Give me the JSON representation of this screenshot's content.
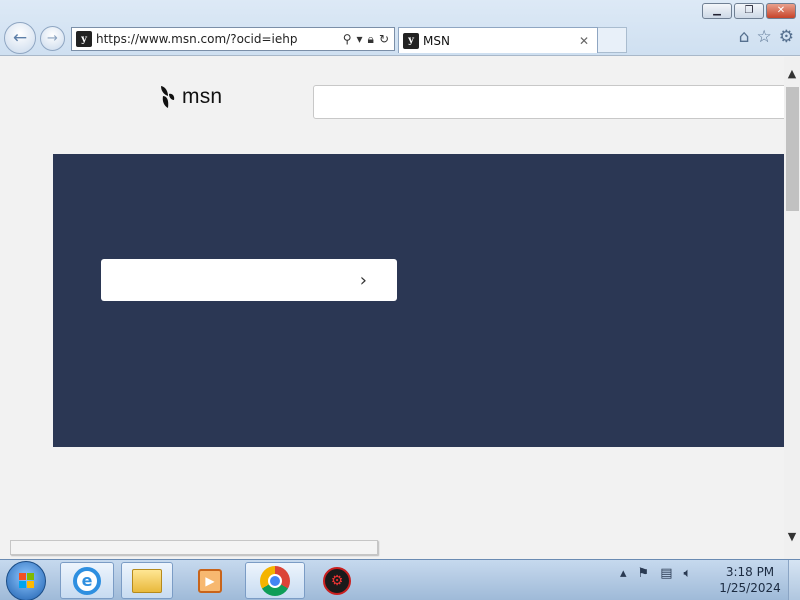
{
  "window": {
    "minimize_icon": "minimize-icon",
    "maximize_icon": "restore-icon",
    "close_icon": "close-icon"
  },
  "browser": {
    "address": {
      "url": "https://www.msn.com/?ocid=iehp",
      "site_icon": "msn-favicon"
    },
    "tabs": [
      {
        "label": "MSN",
        "icon": "msn-favicon"
      }
    ],
    "command_icons": [
      "home-icon",
      "favorites-icon",
      "gear-icon"
    ]
  },
  "page": {
    "logo": {
      "text": "msn",
      "icon": "butterfly-icon"
    },
    "search": {
      "value": "",
      "placeholder": ""
    },
    "hero": {
      "color": "#2b3754",
      "button_icon": "chevron-right-icon"
    }
  },
  "taskbar": {
    "apps": [
      {
        "name": "Internet Explorer",
        "icon": "ie-icon",
        "active": true
      },
      {
        "name": "Windows Explorer",
        "icon": "folder-icon",
        "active": true
      },
      {
        "name": "Windows Media Player",
        "icon": "media-player-icon",
        "active": false
      },
      {
        "name": "Google Chrome",
        "icon": "chrome-icon",
        "active": true
      },
      {
        "name": "App",
        "icon": "app-icon",
        "active": false
      }
    ],
    "tray_icons": [
      "show-hidden-icons",
      "action-center-icon",
      "network-icon",
      "volume-icon"
    ],
    "clock": {
      "time": "3:18 PM",
      "date": "1/25/2024"
    }
  }
}
